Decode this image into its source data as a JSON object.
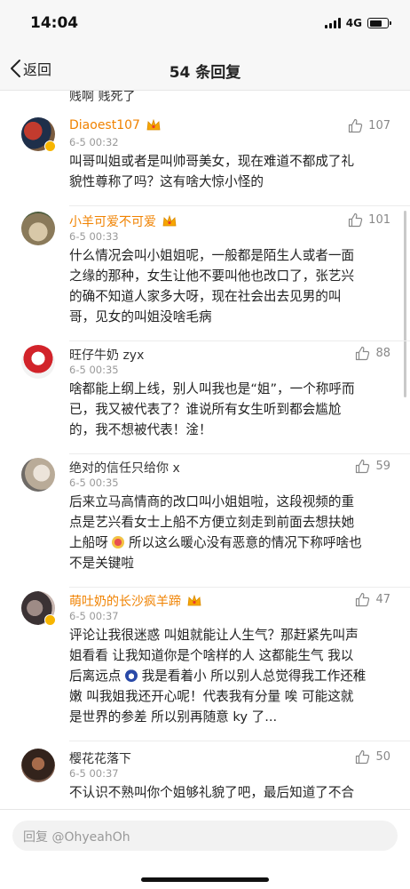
{
  "status_bar": {
    "time": "14:04",
    "network": "4G",
    "battery_level": 0.7
  },
  "nav": {
    "back_label": "返回",
    "title": "54 条回复"
  },
  "previous_tail": "贱啊 贱死了",
  "comments": [
    {
      "username": "Diaoest107",
      "vip": true,
      "verified": true,
      "time": "6-5 00:32",
      "likes": "107",
      "lines": [
        "叫哥叫姐或者是叫帅哥美女，现在难道不都成了礼",
        "貌性尊称了吗？这有啥大惊小怪的"
      ]
    },
    {
      "username": "小羊可爱不可爱",
      "vip": true,
      "verified": false,
      "time": "6-5 00:33",
      "likes": "101",
      "lines": [
        "什么情况会叫小姐姐呢，一般都是陌生人或者一面",
        "之缘的那种，女生让他不要叫他也改口了，张艺兴",
        "的确不知道人家多大呀，现在社会出去见男的叫",
        "哥，见女的叫姐没啥毛病"
      ]
    },
    {
      "username": "旺仔牛奶 zyx",
      "vip": false,
      "verified": false,
      "time": "6-5 00:35",
      "likes": "88",
      "lines": [
        "啥都能上纲上线，别人叫我也是“姐”，一个称呼而",
        "已，我又被代表了？谁说所有女生听到都会尴尬",
        "的，我不想被代表！淦！"
      ]
    },
    {
      "username": "绝对的信任只给你 x",
      "vip": false,
      "verified": false,
      "time": "6-5 00:35",
      "likes": "59",
      "lines": [
        "后来立马高情商的改口叫小姐姐啦，这段视频的重",
        "点是艺兴看女士上船不方便立刻走到前面去想扶她",
        "上船呀 [emoji] 所以这么暖心没有恶意的情况下称呼啥也",
        "不是关键啦"
      ]
    },
    {
      "username": "萌吐奶的长沙疯羊蹄",
      "vip": true,
      "verified": true,
      "time": "6-5 00:37",
      "likes": "47",
      "lines": [
        "评论让我很迷惑 叫姐就能让人生气？那赶紧先叫声",
        "姐看看 让我知道你是个啥样的人 这都能生气 我以",
        "后离远点 [emoji] 我是看着小 所以别人总觉得我工作还稚",
        "嫩 叫我姐我还开心呢！代表我有分量 唉 可能这就",
        "是世界的参差 所以别再随意 ky 了..."
      ]
    },
    {
      "username": "樱花花落下",
      "vip": false,
      "verified": false,
      "time": "6-5 00:37",
      "likes": "50",
      "lines": [
        "不认识不熟叫你个姐够礼貌了吧，最后知道了不合"
      ]
    }
  ],
  "reply": {
    "placeholder": "回复 @OhyeahOh"
  },
  "colors": {
    "vip_name": "#f08200",
    "muted": "#999999",
    "text": "#222222",
    "bar_bg": "#f7f7f7"
  },
  "icons": {
    "back": "chevron-left-icon",
    "like": "thumbs-up-icon",
    "crown": "crown-icon"
  }
}
